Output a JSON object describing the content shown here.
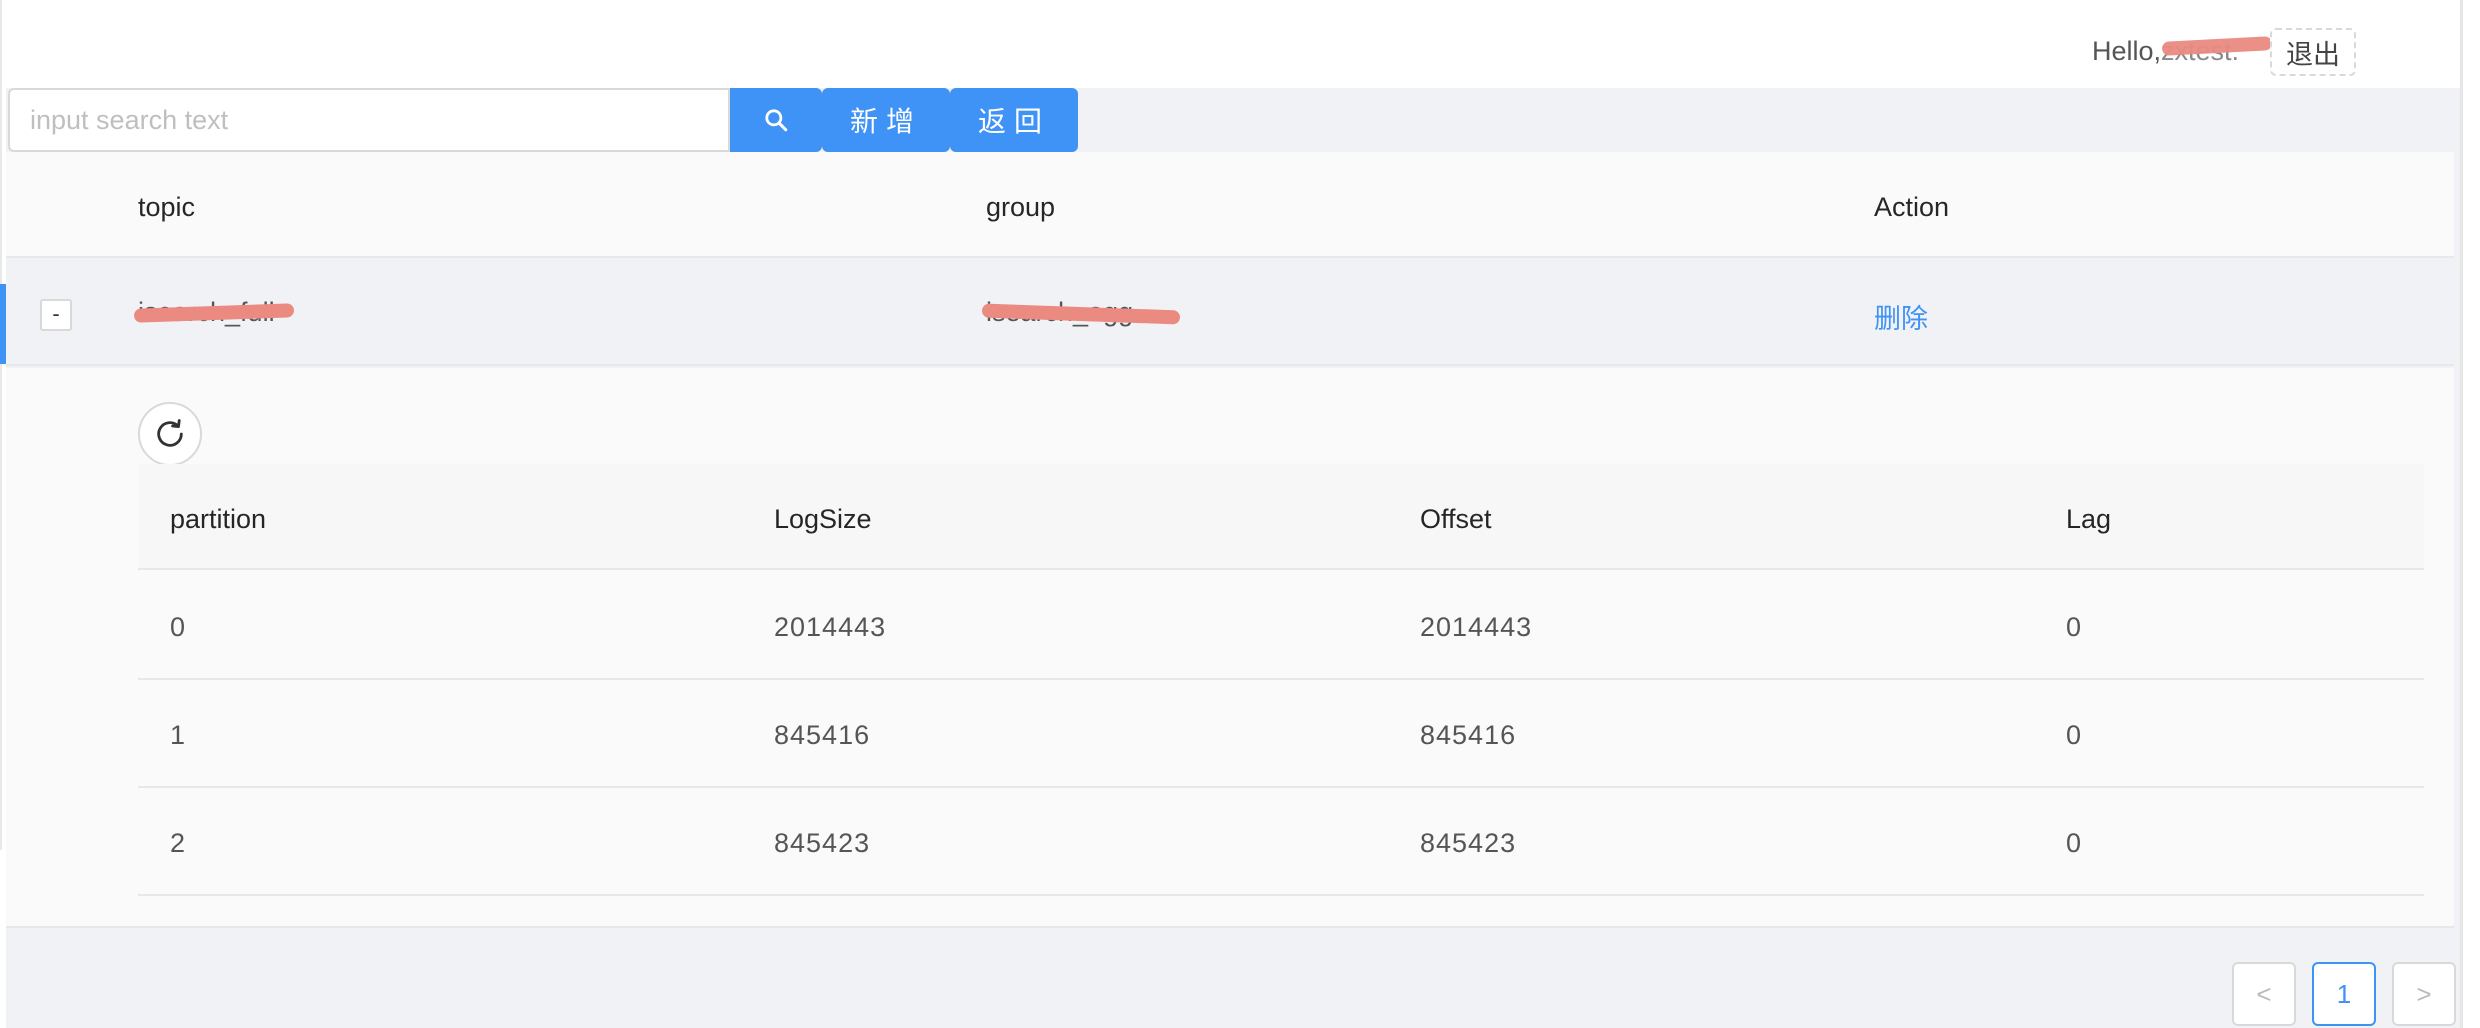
{
  "header": {
    "greeting_prefix": "Hello,",
    "username": "zxtest.",
    "logout_label": "退出"
  },
  "search": {
    "placeholder": "input search text",
    "value": "",
    "search_icon": "search-icon",
    "add_label": "新增",
    "back_label": "返回"
  },
  "table": {
    "columns": [
      "topic",
      "group",
      "Action"
    ],
    "rows": [
      {
        "expand_symbol": "-",
        "topic": "isearch_full",
        "group": "isearch_agg",
        "action": "删除"
      }
    ]
  },
  "expanded": {
    "refresh_icon": "refresh-icon",
    "columns": [
      "partition",
      "LogSize",
      "Offset",
      "Lag"
    ],
    "rows": [
      {
        "partition": "0",
        "logsize": "2014443",
        "offset": "2014443",
        "lag": "0"
      },
      {
        "partition": "1",
        "logsize": "845416",
        "offset": "845416",
        "lag": "0"
      },
      {
        "partition": "2",
        "logsize": "845423",
        "offset": "845423",
        "lag": "0"
      }
    ]
  },
  "pagination": {
    "prev": "<",
    "current": "1",
    "next": ">"
  },
  "colors": {
    "primary": "#3f92f6",
    "redaction": "#ea8a80",
    "background": "#f0f2f5"
  }
}
